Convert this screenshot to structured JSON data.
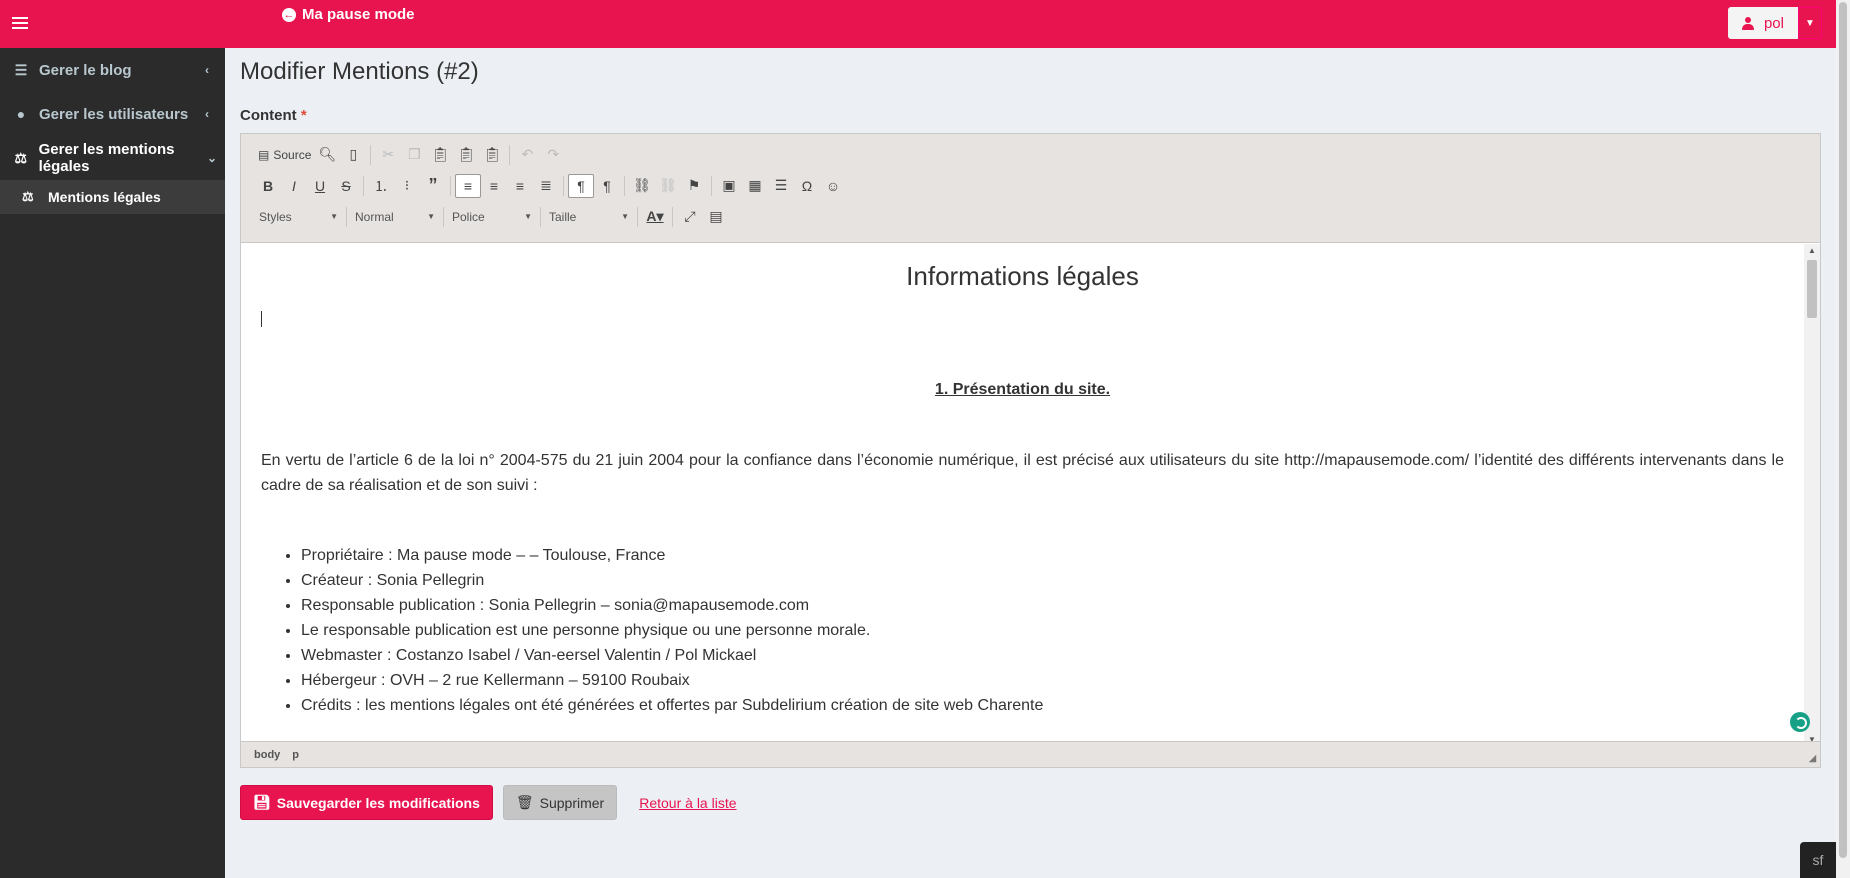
{
  "header": {
    "brand": "Ma pause mode",
    "user": "pol"
  },
  "sidebar": {
    "items": [
      {
        "label": "Gerer le blog",
        "icon": "list-icon"
      },
      {
        "label": "Gerer les utilisateurs",
        "icon": "user-circle-icon"
      },
      {
        "label": "Gerer les mentions légales",
        "icon": "balance-scale-icon"
      }
    ],
    "sub_item": "Mentions légales"
  },
  "page": {
    "title": "Modifier Mentions (#2)",
    "field_label": "Content",
    "required_mark": "*"
  },
  "toolbar": {
    "source": "Source",
    "styles": "Styles",
    "format": "Normal",
    "font": "Police",
    "size": "Taille"
  },
  "document": {
    "heading": "Informations légales",
    "section_title": "1. Présentation du site.",
    "intro": "En vertu de l’article 6 de la loi n° 2004-575 du 21 juin 2004 pour la confiance dans l’économie numérique, il est précisé aux utilisateurs du site http://mapausemode.com/ l’identité des différents intervenants dans le cadre de sa réalisation et de son suivi :",
    "list": [
      "Propriétaire : Ma pause mode – – Toulouse, France",
      "Créateur : Sonia Pellegrin",
      "Responsable publication : Sonia Pellegrin – sonia@mapausemode.com",
      "Le responsable publication est une personne physique ou une personne morale.",
      "Webmaster : Costanzo Isabel / Van-eersel Valentin / Pol Mickael",
      "Hébergeur : OVH – 2 rue Kellermann – 59100 Roubaix",
      "Crédits : les mentions légales ont été générées et offertes par Subdelirium création de site web Charente"
    ]
  },
  "statusbar": {
    "path": [
      "body",
      "p"
    ]
  },
  "actions": {
    "save": "Sauvegarder les modifications",
    "delete": "Supprimer",
    "back": "Retour à la liste"
  },
  "colors": {
    "brand": "#e8144f",
    "sidebar": "#2b2b2b",
    "content_bg": "#ecf0f5"
  }
}
